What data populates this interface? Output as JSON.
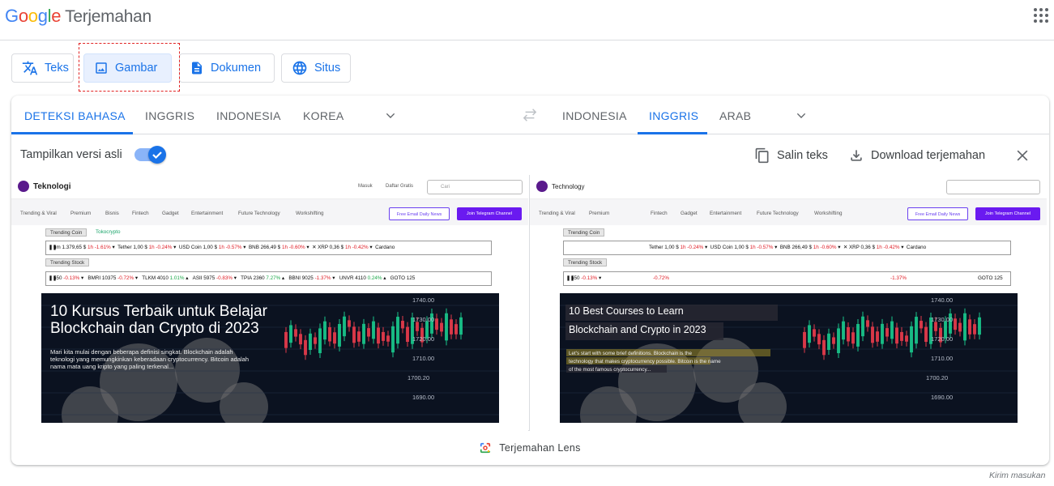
{
  "app": {
    "logo_text": "Google",
    "product": "Terjemahan"
  },
  "modes": [
    {
      "label": "Teks",
      "icon": "translate-icon"
    },
    {
      "label": "Gambar",
      "icon": "image-icon"
    },
    {
      "label": "Dokumen",
      "icon": "document-icon"
    },
    {
      "label": "Situs",
      "icon": "globe-icon"
    }
  ],
  "source_langs": [
    "DETEKSI BAHASA",
    "INGGRIS",
    "INDONESIA",
    "KOREA"
  ],
  "target_langs": [
    "INDONESIA",
    "INGGRIS",
    "ARAB"
  ],
  "options": {
    "show_original_label": "Tampilkan versi asli",
    "show_original_on": true,
    "copy_text": "Salin teks",
    "download": "Download terjemahan"
  },
  "original": {
    "site_name": "Teknologi",
    "links": [
      "Masuk",
      "Daftar Gratis"
    ],
    "search_placeholder": "Cari",
    "nav": [
      "Trending & Viral",
      "Premium",
      "Bisnis",
      "Fintech",
      "Gadget",
      "Entertainment",
      "Future Technology",
      "Workshifting"
    ],
    "btn_free": "Free Email Daily News",
    "btn_join": "Join Telegram Channel",
    "trending_coin_label": "Trending Coin",
    "tokocrypto": "Tokocrypto",
    "coin_ticker_a": "um 1.379,65 $",
    "coin_ticker_a_chg": "1h -1.61%",
    "coin_ticker_b": "Tether 1,00 $",
    "coin_ticker_b_chg": "1h -0.24%",
    "coin_ticker_c": "USD Coin 1,00 $",
    "coin_ticker_c_chg": "1h -0.57%",
    "coin_ticker_d": "BNB 266,49 $",
    "coin_ticker_d_chg": "1h -0.60%",
    "coin_ticker_e": "XRP 0,36 $",
    "coin_ticker_e_chg": "1h -0.42%",
    "coin_ticker_f": "Cardano",
    "trending_stock_label": "Trending Stock",
    "stock_a": "550",
    "stock_a_chg": "-0.13%",
    "stock_b": "BMRI 10375",
    "stock_b_chg": "-0.72%",
    "stock_c": "TLKM 4010",
    "stock_c_chg": "1.01%",
    "stock_d": "ASII 5975",
    "stock_d_chg": "-0.83%",
    "stock_e": "TPIA 2360",
    "stock_e_chg": "7.27%",
    "stock_f": "BBNI 9025",
    "stock_f_chg": "-1.37%",
    "stock_g": "UNVR 4110",
    "stock_g_chg": "0.24%",
    "stock_h": "GOTO 125",
    "hero_title": "10 Kursus Terbaik untuk Belajar\nBlockchain dan Crypto di 2023",
    "hero_desc": "Mari kita mulai dengan beberapa definisi singkat. Blockchain adalah\nteknologi yang memungkinkan keberadaan cryptocurrency. Bitcoin adalah\nnama mata uang kripto yang paling terkenal..."
  },
  "translated": {
    "site_name": "Technology",
    "nav": [
      "Trending & Viral",
      "Premium",
      "Fintech",
      "Gadget",
      "Entertainment",
      "Future Technology",
      "Workshifting"
    ],
    "btn_free": "Free Email Daily News",
    "btn_join": "Join Telegram Channel",
    "trending_coin_label": "Trending Coin",
    "coin_ticker": "Tether 1,00 $",
    "coin_ticker_chg": "1h -0.24%",
    "coin_usd": "USD Coin 1,00 $",
    "coin_usd_chg": "1h -0.57%",
    "coin_bnb": "BNB 266,49 $",
    "coin_bnb_chg": "1h -0.60%",
    "coin_xrp": "XRP 0,36 $",
    "coin_xrp_chg": "1h -0.42%",
    "coin_cardano": "Cardano",
    "trending_stock_label": "Trending Stock",
    "stock_a": "550",
    "stock_a_chg": "-0.13%",
    "stock_b_chg": "-0.72%",
    "stock_f_chg": "-1.37%",
    "stock_h": "GOTO 125",
    "hero_title": "10 Best Courses to Learn\nBlockchain and Crypto in 2023",
    "hero_desc": "Let's start with some brief definitions. Blockchain is the\ntechnology that makes cryptocurrency possible. Bitcoin is the name\nof the most famous cryptocurrency..."
  },
  "chart_prices": [
    "1740.00",
    "1730.00",
    "1720.00",
    "1710.00",
    "1700.20",
    "1690.00"
  ],
  "lens_label": "Terjemahan Lens",
  "feedback": "Kirim masukan"
}
